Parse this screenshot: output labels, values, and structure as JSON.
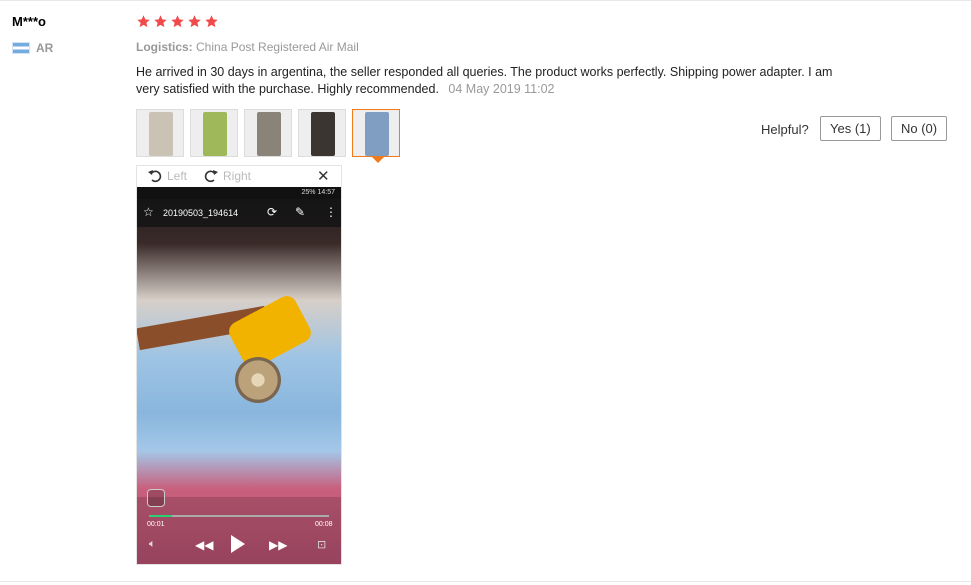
{
  "reviewer": {
    "name": "M***o",
    "country_code": "AR"
  },
  "rating": {
    "stars": 5,
    "max": 5,
    "color": "#f04a4a"
  },
  "logistics": {
    "label": "Logistics:",
    "value": "China Post Registered Air Mail"
  },
  "review": {
    "text": "He arrived in 30 days in argentina, the seller responded all queries. The product works perfectly. Shipping power adapter. I am very satisfied with the purchase. Highly recommended.",
    "date": "04 May 2019 11:02"
  },
  "thumbnails": [
    {
      "name": "photo-1",
      "active": false,
      "color": "#c9c2b5"
    },
    {
      "name": "photo-2",
      "active": false,
      "color": "#9fb85a"
    },
    {
      "name": "photo-3",
      "active": false,
      "color": "#8a8378"
    },
    {
      "name": "photo-4",
      "active": false,
      "color": "#3b3532"
    },
    {
      "name": "photo-5",
      "active": true,
      "color": "#7f9ec2"
    }
  ],
  "viewer": {
    "rotate_left_label": "Left",
    "rotate_right_label": "Right",
    "close_glyph": "✕",
    "photo": {
      "status_text": "25% 14:57",
      "filename": "20190503_194614",
      "time_elapsed": "00:01",
      "time_total": "00:08",
      "progress": 0.125
    }
  },
  "helpful": {
    "label": "Helpful?",
    "yes_label": "Yes (1)",
    "no_label": "No (0)"
  },
  "colors": {
    "accent": "#f17a1d",
    "muted": "#999999"
  }
}
